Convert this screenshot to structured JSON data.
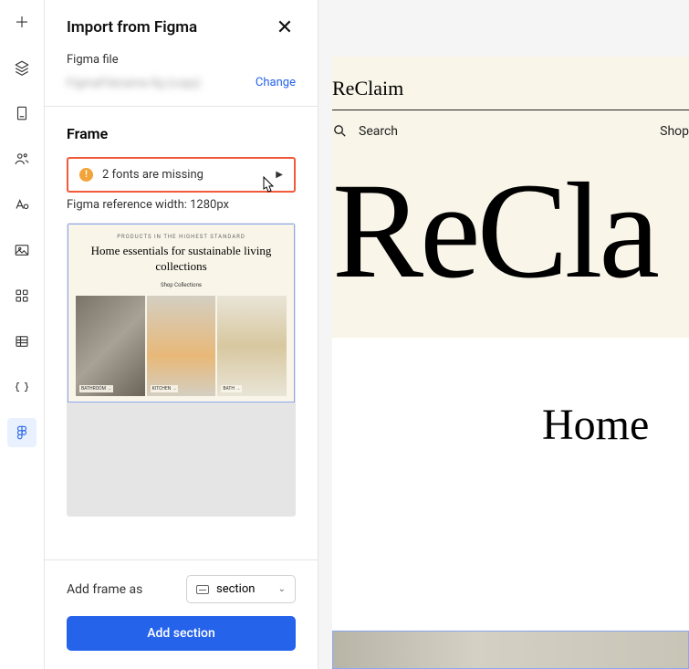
{
  "panel": {
    "title": "Import from Figma",
    "file_label": "Figma file",
    "file_name_blurred": "FigmaFilename.fig (copy)",
    "change": "Change",
    "frame_heading": "Frame",
    "warning": "2 fonts are missing",
    "ref_width": "Figma reference width: 1280px",
    "thumb": {
      "eyebrow": "PRODUCTS IN THE HIGHEST STANDARD",
      "headline": "Home essentials for sustainable living collections",
      "cta": "Shop Collections",
      "labels": [
        "BATHROOM →",
        "KITCHEN →",
        "BATH →"
      ]
    },
    "add_frame_as": "Add frame as",
    "select_value": "section",
    "primary": "Add section"
  },
  "preview": {
    "brand": "ReClaim",
    "search": "Search",
    "nav_shop": "Shop",
    "big_brand": "ReCla",
    "hero_heading": "Home"
  }
}
